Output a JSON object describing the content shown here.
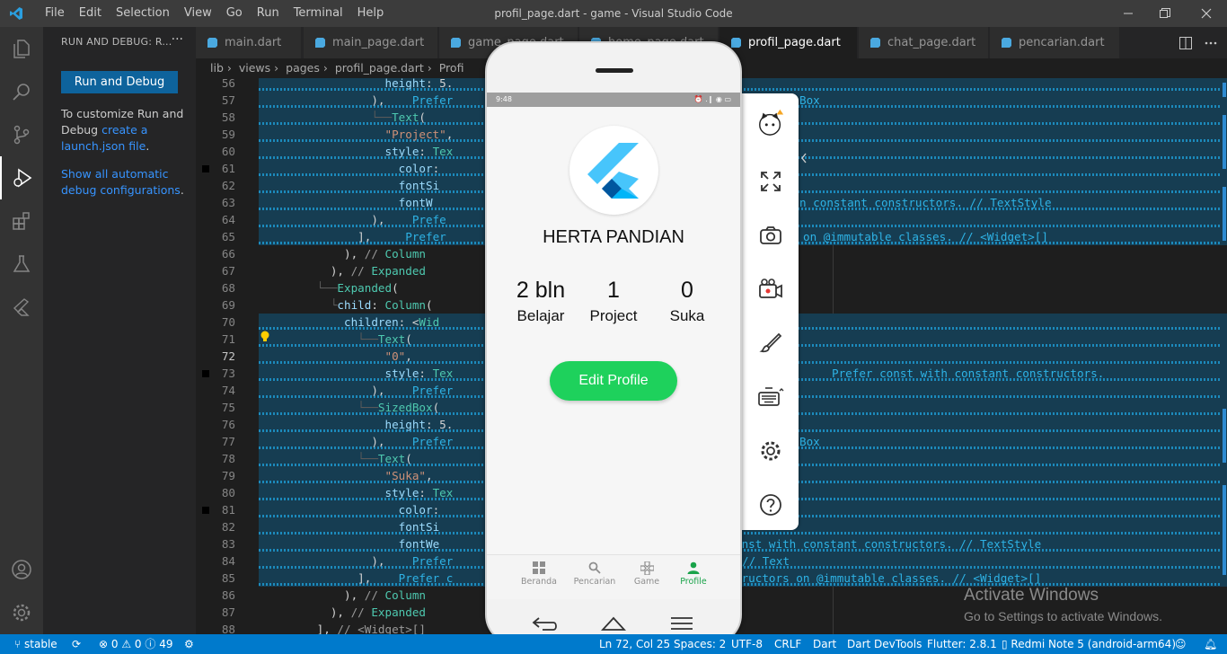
{
  "window": {
    "title": "profil_page.dart - game - Visual Studio Code",
    "menu": [
      "File",
      "Edit",
      "Selection",
      "View",
      "Go",
      "Run",
      "Terminal",
      "Help"
    ]
  },
  "sidebar": {
    "header": "RUN AND DEBUG: R...",
    "more": "···",
    "run_button": "Run and Debug",
    "customize_text": "To customize Run and Debug",
    "customize_link": "create a launch.json file",
    "customize_end": ".",
    "show_link": "Show all automatic debug configurations",
    "show_end": "."
  },
  "tabs": [
    {
      "label": "main.dart",
      "active": false
    },
    {
      "label": "main_page.dart",
      "active": false
    },
    {
      "label": "game_page.dart",
      "active": false
    },
    {
      "label": "home_page.dart",
      "active": false
    },
    {
      "label": "profil_page.dart",
      "active": true
    },
    {
      "label": "chat_page.dart",
      "active": false
    },
    {
      "label": "pencarian.dart",
      "active": false
    }
  ],
  "breadcrumb": [
    "lib",
    "views",
    "pages",
    "profil_page.dart",
    "Profi"
  ],
  "editor": {
    "lines": [
      {
        "n": "56",
        "c": "                  height: 5.",
        "r": "",
        "hl": true,
        "bp": false
      },
      {
        "n": "57",
        "c": "                ),    Prefer",
        "r": "Box",
        "rx": 672,
        "hl": true,
        "bp": false
      },
      {
        "n": "58",
        "c": "                └──Text(",
        "r": "",
        "hl": true,
        "bp": false
      },
      {
        "n": "59",
        "c": "                  \"Project\",",
        "r": "",
        "hl": true,
        "bp": false
      },
      {
        "n": "60",
        "c": "                  style: Tex",
        "r": "",
        "hl": true,
        "bp": false
      },
      {
        "n": "61",
        "c": "                    color:",
        "r": "",
        "hl": true,
        "bp": true
      },
      {
        "n": "62",
        "c": "                    fontSi",
        "r": "",
        "hl": true,
        "bp": false
      },
      {
        "n": "63",
        "c": "                    fontW",
        "r": "n constant constructors. // TextStyle",
        "rx": 672,
        "hl": true,
        "bp": false
      },
      {
        "n": "64",
        "c": "                ),    Prefe",
        "r": "",
        "hl": true,
        "bp": false
      },
      {
        "n": "65",
        "c": "              ],     Prefer",
        "r": "on @immutable classes. // <Widget>[]",
        "rx": 676,
        "hl": true,
        "bp": false
      },
      {
        "n": "66",
        "c": "            ), // Column",
        "r": "",
        "hl": false,
        "bp": false
      },
      {
        "n": "67",
        "c": "          ), // Expanded",
        "r": "",
        "hl": false,
        "bp": false
      },
      {
        "n": "68",
        "c": "        └──Expanded(",
        "r": "",
        "hl": false,
        "bp": false
      },
      {
        "n": "69",
        "c": "          └child: Column(",
        "r": "",
        "hl": false,
        "bp": false
      },
      {
        "n": "70",
        "c": "            children: <Wid",
        "r": "",
        "hl": true,
        "bp": false
      },
      {
        "n": "71",
        "c": "              └──Text(",
        "r": "",
        "hl": true,
        "bp": false
      },
      {
        "n": "72",
        "c": "                  \"0\",",
        "r": "",
        "hl": true,
        "bp": false
      },
      {
        "n": "73",
        "c": "                  style: Tex",
        "r": "Prefer const with constant constructors.",
        "rx": 708,
        "hl": true,
        "bp": true
      },
      {
        "n": "74",
        "c": "                ),    Prefer",
        "r": "",
        "hl": true,
        "bp": false
      },
      {
        "n": "75",
        "c": "              └──SizedBox(",
        "r": "",
        "hl": true,
        "bp": false
      },
      {
        "n": "76",
        "c": "                  height: 5.",
        "r": "",
        "hl": true,
        "bp": false
      },
      {
        "n": "77",
        "c": "                ),    Prefer",
        "r": "Box",
        "rx": 672,
        "hl": true,
        "bp": false
      },
      {
        "n": "78",
        "c": "              └──Text(",
        "r": "",
        "hl": true,
        "bp": false
      },
      {
        "n": "79",
        "c": "                  \"Suka\",",
        "r": "",
        "hl": true,
        "bp": false
      },
      {
        "n": "80",
        "c": "                  style: Tex",
        "r": "",
        "hl": true,
        "bp": false
      },
      {
        "n": "81",
        "c": "                    color:",
        "r": "",
        "hl": true,
        "bp": true
      },
      {
        "n": "82",
        "c": "                    fontSi",
        "r": "",
        "hl": true,
        "bp": false
      },
      {
        "n": "83",
        "c": "                    fontWe",
        "r": "onst with constant constructors. // TextStyle",
        "rx": 600,
        "hl": true,
        "bp": false
      },
      {
        "n": "84",
        "c": "                ),    Prefer",
        "r": "// Text",
        "rx": 608,
        "hl": true,
        "bp": false
      },
      {
        "n": "85",
        "c": "              ],    Prefer c",
        "r": "tructors on @immutable classes. // <Widget>[]",
        "rx": 600,
        "hl": true,
        "bp": false
      },
      {
        "n": "86",
        "c": "            ), // Column",
        "r": "",
        "hl": false,
        "bp": false
      },
      {
        "n": "87",
        "c": "          ), // Expanded",
        "r": "",
        "hl": false,
        "bp": false
      },
      {
        "n": "88",
        "c": "        ], // <Widget>[]",
        "r": "",
        "hl": false,
        "bp": false
      }
    ],
    "current_line": "72"
  },
  "activate": {
    "title": "Activate Windows",
    "subtitle": "Go to Settings to activate Windows."
  },
  "statusbar": {
    "branch": "stable",
    "errors": "0",
    "warnings": "0",
    "infos": "49",
    "position": "Ln 72, Col 25",
    "spaces": "Spaces: 2",
    "encoding": "UTF-8",
    "eol": "CRLF",
    "language": "Dart",
    "devtools": "Dart DevTools",
    "flutter": "Flutter: 2.8.1",
    "device": "Redmi Note 5 (android-arm64)"
  },
  "phone": {
    "time": "9:48",
    "status_icons": "⏰ .❙ ◉ ▭",
    "name": "HERTA PANDIAN",
    "stats": [
      {
        "value": "2 bln",
        "label": "Belajar"
      },
      {
        "value": "1",
        "label": "Project"
      },
      {
        "value": "0",
        "label": "Suka"
      }
    ],
    "edit_button": "Edit Profile",
    "nav": [
      {
        "label": "Beranda",
        "icon": "grid-icon",
        "active": false
      },
      {
        "label": "Pencarian",
        "icon": "search-icon",
        "active": false
      },
      {
        "label": "Game",
        "icon": "game-icon",
        "active": false
      },
      {
        "label": "Profile",
        "icon": "person-icon",
        "active": true
      }
    ]
  },
  "colors": {
    "accent": "#007acc",
    "edit_button": "#1ed15c",
    "nav_active": "#1aa34a",
    "highlight": "#163d52"
  }
}
